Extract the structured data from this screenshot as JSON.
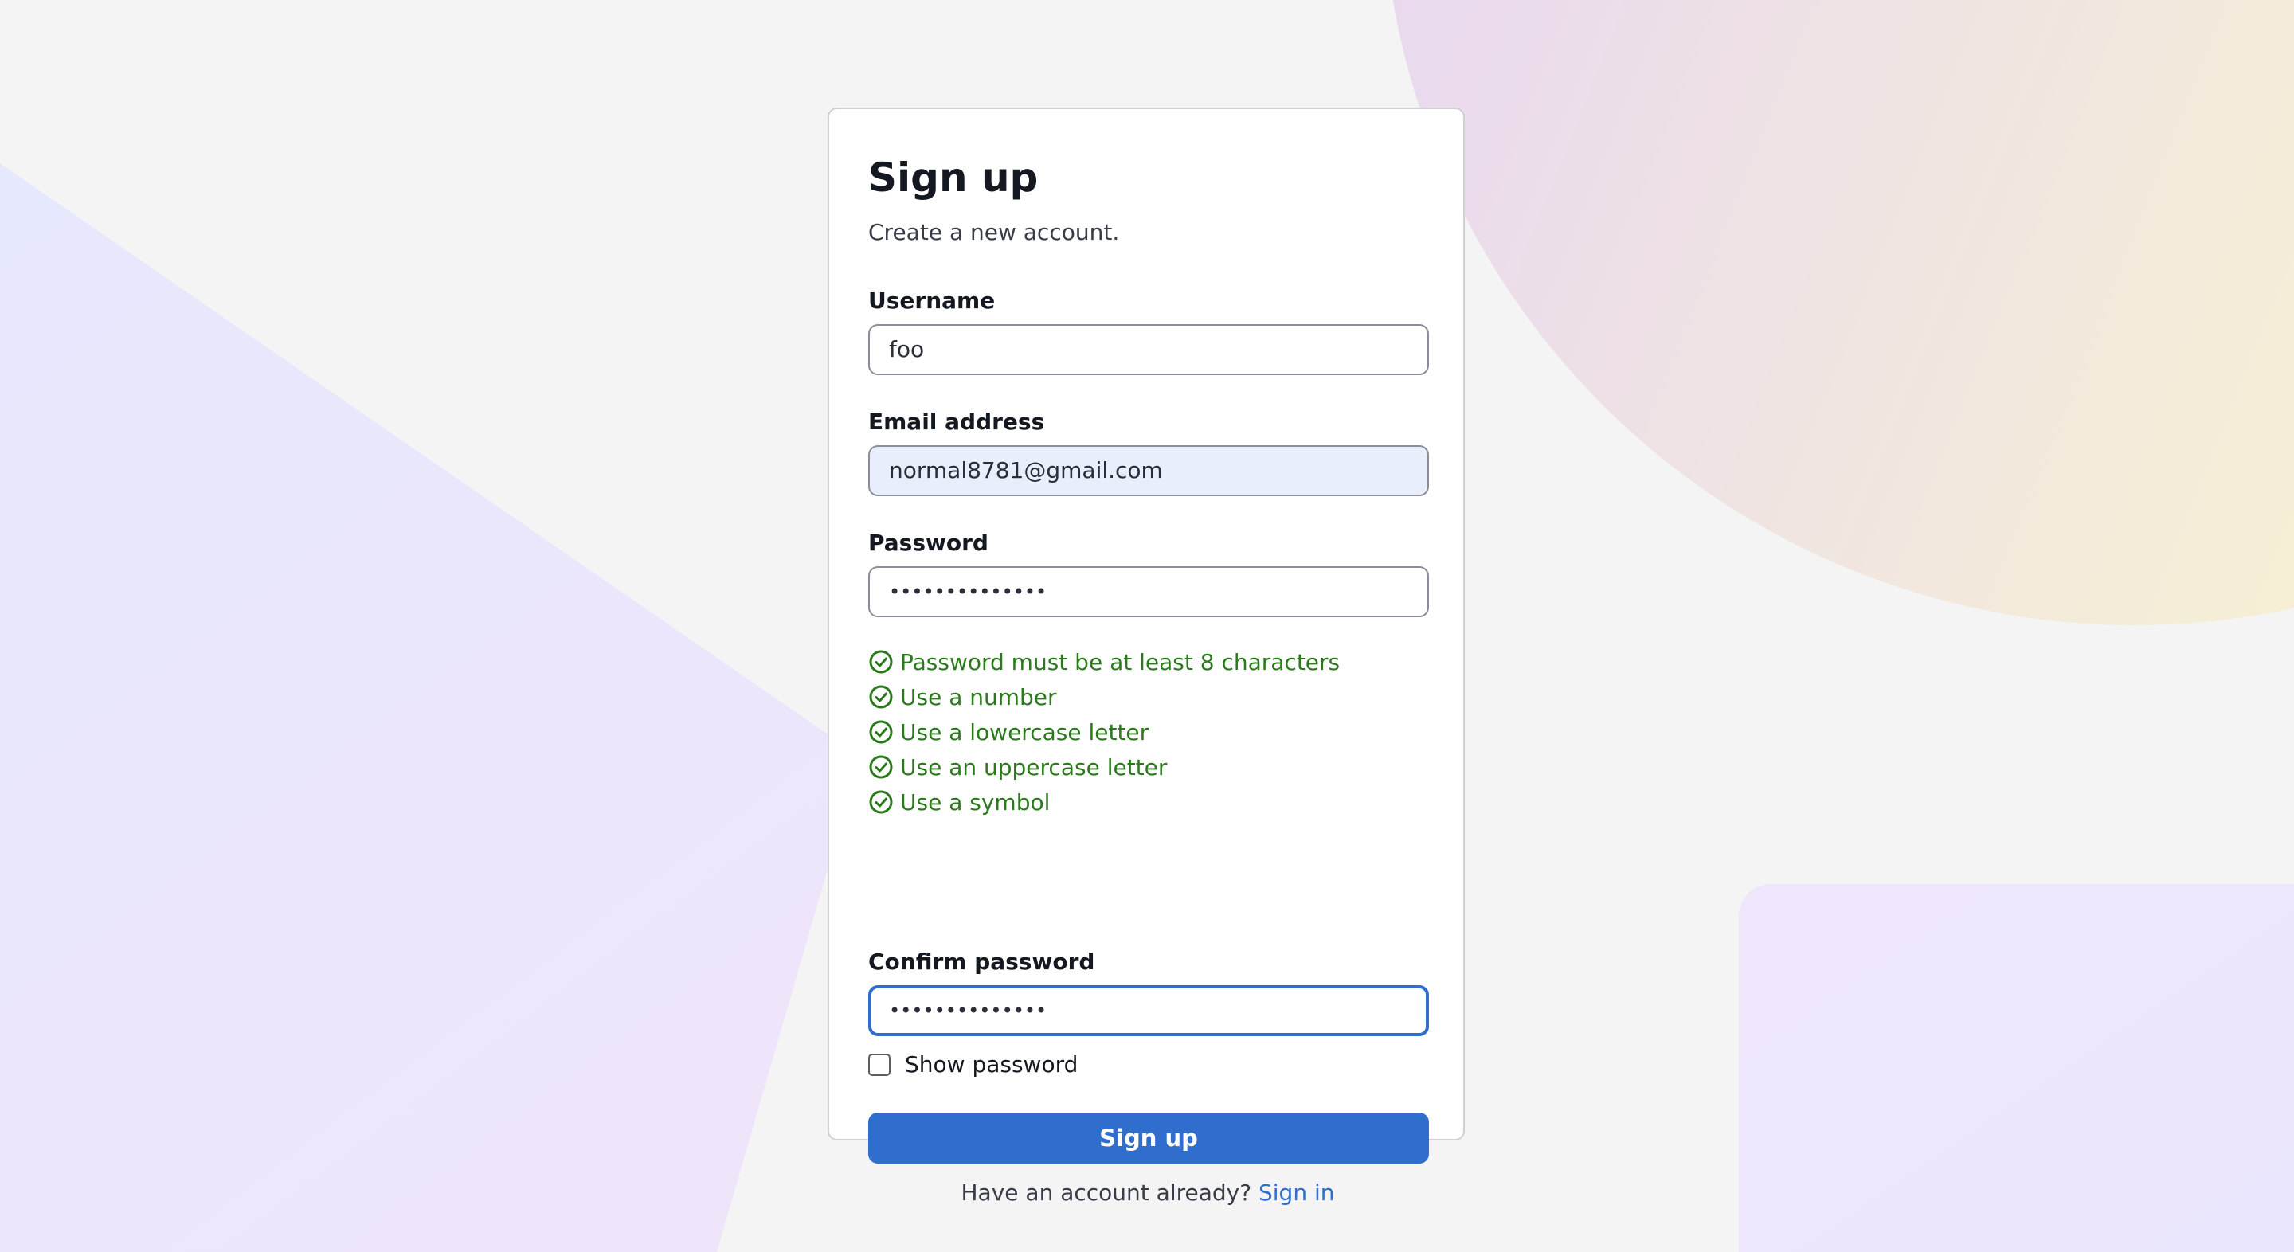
{
  "colors": {
    "background": "#f4f4f4",
    "card": "#ffffff",
    "primary": "#2f6ecc",
    "success": "#2a7a1c",
    "autofill": "#e8eefb"
  },
  "form": {
    "title": "Sign up",
    "subtitle": "Create a new account.",
    "username": {
      "label": "Username",
      "value": "foo"
    },
    "email": {
      "label": "Email address",
      "value": "normal8781@gmail.com"
    },
    "password": {
      "label": "Password",
      "masked_value": "••••••••••••••"
    },
    "rules": [
      {
        "text": "Password must be at least 8 characters",
        "icon": "check-circle-icon"
      },
      {
        "text": "Use a number",
        "icon": "check-circle-icon"
      },
      {
        "text": "Use a lowercase letter",
        "icon": "check-circle-icon"
      },
      {
        "text": "Use an uppercase letter",
        "icon": "check-circle-icon"
      },
      {
        "text": "Use a symbol",
        "icon": "check-circle-icon"
      }
    ],
    "confirm_password": {
      "label": "Confirm password",
      "masked_value": "••••••••••••••"
    },
    "show_password": {
      "label": "Show password",
      "checked": false
    },
    "submit_label": "Sign up",
    "footer": {
      "prompt": "Have an account already?",
      "link_label": "Sign in"
    }
  }
}
